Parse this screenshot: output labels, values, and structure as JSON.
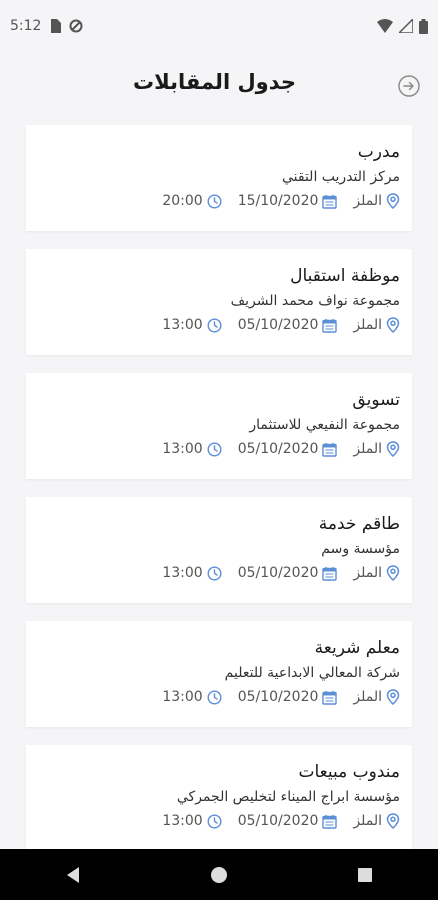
{
  "status": {
    "time": "5:12"
  },
  "header": {
    "title": "جدول المقابلات"
  },
  "colors": {
    "accent": "#5b8fd6",
    "background": "#f5f5f7"
  },
  "interviews": [
    {
      "job_title": "مدرب",
      "company": "مركز التدريب التقني",
      "location": "الملز",
      "date": "15/10/2020",
      "time": "20:00"
    },
    {
      "job_title": "موظفة استقبال",
      "company": "مجموعة نواف محمد الشريف",
      "location": "الملز",
      "date": "05/10/2020",
      "time": "13:00"
    },
    {
      "job_title": "تسويق",
      "company": "مجموعة النفيعي للاستثمار",
      "location": "الملز",
      "date": "05/10/2020",
      "time": "13:00"
    },
    {
      "job_title": "طاقم خدمة",
      "company": "مؤسسة وسم",
      "location": "الملز",
      "date": "05/10/2020",
      "time": "13:00"
    },
    {
      "job_title": "معلم شريعة",
      "company": "شركة المعالي الابداعية للتعليم",
      "location": "الملز",
      "date": "05/10/2020",
      "time": "13:00"
    },
    {
      "job_title": "مندوب مبيعات",
      "company": "مؤسسة ابراج الميناء لتخليص الجمركي",
      "location": "الملز",
      "date": "05/10/2020",
      "time": "13:00"
    }
  ]
}
